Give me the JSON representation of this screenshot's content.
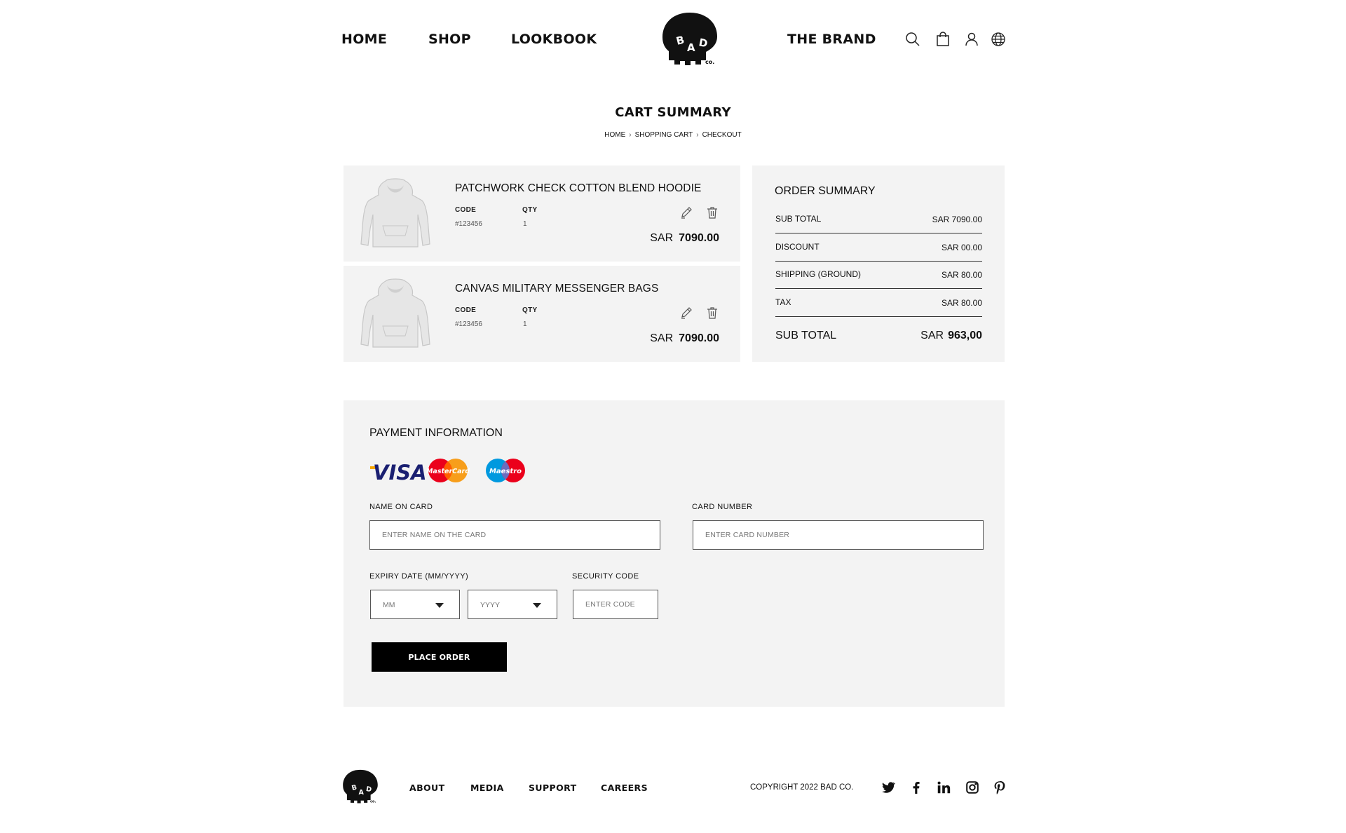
{
  "header": {
    "nav": [
      "HOME",
      "SHOP",
      "LOOKBOOK",
      "THE BRAND"
    ],
    "logo_text": "BAD CO.",
    "icons": [
      "search-icon",
      "shopping-bag-icon",
      "user-icon",
      "globe-icon"
    ]
  },
  "page": {
    "title": "CART SUMMARY",
    "breadcrumb": [
      "HOME",
      "SHOPPING CART",
      "CHECKOUT"
    ]
  },
  "cart": {
    "code_label": "CODE",
    "qty_label": "QTY",
    "currency": "SAR",
    "items": [
      {
        "name": "PATCHWORK CHECK COTTON BLEND HOODIE",
        "code": "#123456",
        "qty": "1",
        "price": "7090.00"
      },
      {
        "name": "CANVAS MILITARY MESSENGER BAGS",
        "code": "#123456",
        "qty": "1",
        "price": "7090.00"
      }
    ]
  },
  "summary": {
    "title": "ORDER SUMMARY",
    "rows": [
      {
        "label": "SUB TOTAL",
        "value": "SAR 7090.00"
      },
      {
        "label": "DISCOUNT",
        "value": "SAR 00.00"
      },
      {
        "label": "SHIPPING (GROUND)",
        "value": "SAR 80.00"
      },
      {
        "label": "TAX",
        "value": "SAR 80.00"
      }
    ],
    "total_label": "SUB TOTAL",
    "total_currency": "SAR",
    "total_value": "963,00"
  },
  "payment": {
    "title": "PAYMENT INFORMATION",
    "card_logos": {
      "visa": "VISA",
      "mastercard": "MasterCard",
      "maestro": "Maestro"
    },
    "name_label": "NAME ON CARD",
    "name_placeholder": "ENTER NAME ON THE CARD",
    "card_label": "CARD NUMBER",
    "card_placeholder": "ENTER CARD NUMBER",
    "expiry_label": "EXPIRY DATE (MM/YYYY)",
    "month_value": "MM",
    "year_value": "YYYY",
    "security_label": "SECURITY CODE",
    "security_placeholder": "ENTER CODE",
    "button": "PLACE ORDER"
  },
  "footer": {
    "links": [
      "ABOUT",
      "MEDIA",
      "SUPPORT",
      "CAREERS"
    ],
    "copyright": "COPYRIGHT 2022 BAD CO.",
    "social": [
      "twitter-icon",
      "facebook-icon",
      "linkedin-icon",
      "instagram-icon",
      "pinterest-icon"
    ]
  },
  "colors": {
    "panel": "#f3f3f3",
    "button": "#000000",
    "visa_blue": "#1a1f71",
    "visa_gold": "#f7a600",
    "mc_red": "#eb001b",
    "mc_orange": "#f79e1b",
    "maestro_blue": "#0099df"
  }
}
